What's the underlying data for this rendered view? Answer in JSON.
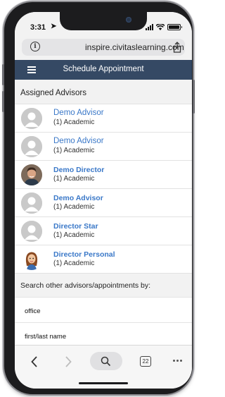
{
  "status_bar": {
    "time": "3:31",
    "location_glyph": "➤"
  },
  "browser": {
    "url": "inspire.civitaslearning.com",
    "tabs_count": "22"
  },
  "app_bar": {
    "title": "Schedule Appointment"
  },
  "assigned": {
    "heading": "Assigned Advisors",
    "advisors": [
      {
        "name": "Demo Advisor",
        "role": "(1) Academic",
        "avatar": "placeholder"
      },
      {
        "name": "Demo Advisor",
        "role": "(1) Academic",
        "avatar": "placeholder"
      },
      {
        "name": "Demo Director",
        "role": "(1) Academic",
        "avatar": "photo"
      },
      {
        "name": "Demo Advisor",
        "role": "(1) Academic",
        "avatar": "placeholder"
      },
      {
        "name": "Director Star",
        "role": "(1) Academic",
        "avatar": "placeholder"
      },
      {
        "name": "Director Personal",
        "role": "(1) Academic",
        "avatar": "cartoon"
      }
    ]
  },
  "search": {
    "heading": "Search other advisors/appointments by:",
    "options": [
      "office",
      "first/last name"
    ]
  },
  "colors": {
    "app_bar": "#354964",
    "link": "#3a78c8"
  }
}
